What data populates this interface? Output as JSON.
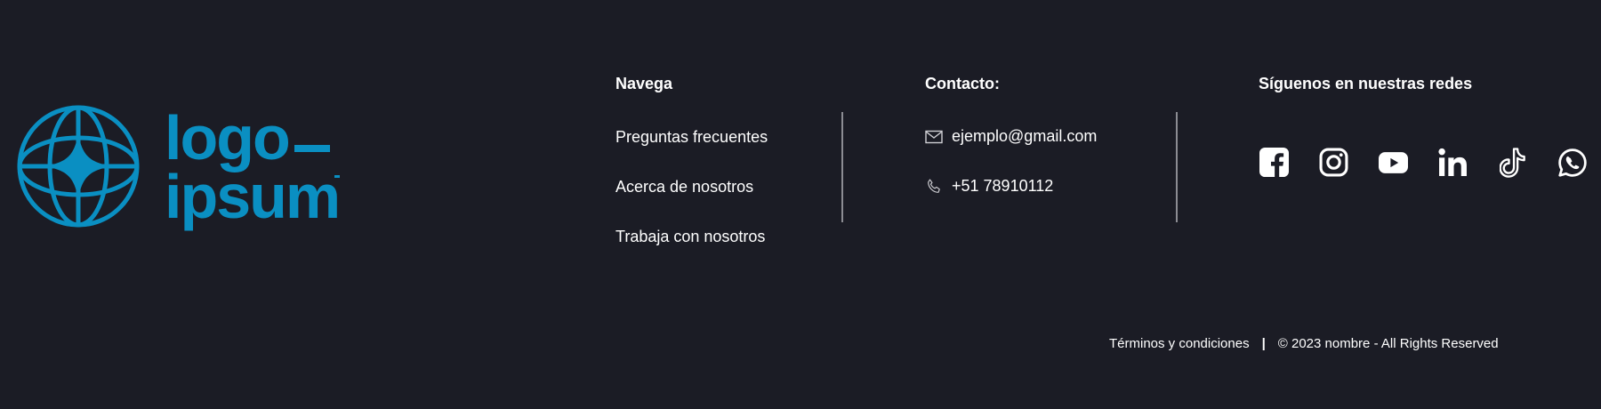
{
  "brand": {
    "logo_text_line1": "logo",
    "logo_text_line2": "ipsum",
    "logo_color": "#0a8fc2"
  },
  "navigation": {
    "title": "Navega",
    "links": [
      {
        "label": "Preguntas frecuentes"
      },
      {
        "label": "Acerca de nosotros"
      },
      {
        "label": "Trabaja con nosotros"
      }
    ]
  },
  "contact": {
    "title": "Contacto:",
    "email": {
      "icon": "envelope-icon",
      "value": "ejemplo@gmail.com"
    },
    "phone": {
      "icon": "phone-icon",
      "value": "+51 78910112"
    }
  },
  "social": {
    "title": "Síguenos en nuestras redes",
    "icons": [
      "facebook-icon",
      "instagram-icon",
      "youtube-icon",
      "linkedin-icon",
      "tiktok-icon",
      "whatsapp-icon"
    ]
  },
  "legal": {
    "terms_label": "Términos y condiciones",
    "separator": "|",
    "copyright": "© 2023 nombre - All Rights Reserved"
  },
  "colors": {
    "background": "#1b1c25",
    "text": "#ffffff",
    "divider": "#8c8c93",
    "accent": "#0a8fc2"
  }
}
